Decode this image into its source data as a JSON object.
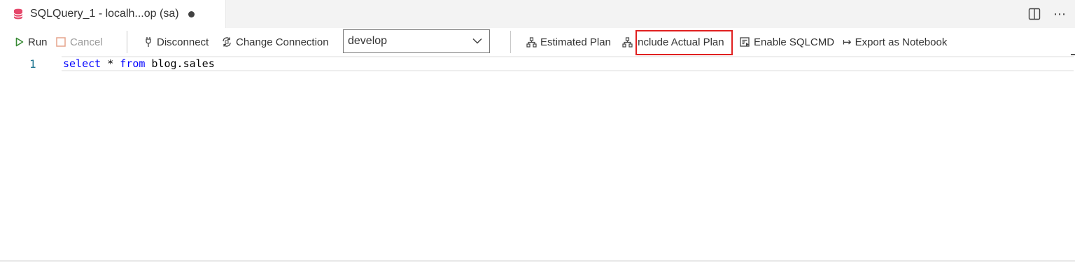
{
  "tab": {
    "title": "SQLQuery_1 - localh...op (sa)",
    "icon": "database-icon",
    "icon_color": "#e5476a"
  },
  "tabbar_actions": {
    "split_icon": "split-editor-icon",
    "more_icon": "more-actions-icon",
    "more_glyph": "⋯"
  },
  "toolbar": {
    "run_label": "Run",
    "cancel_label": "Cancel",
    "disconnect_label": "Disconnect",
    "change_connection_label": "Change Connection",
    "database_selected": "develop",
    "estimated_plan_label": "Estimated Plan",
    "include_actual_plan_label": "Include Actual Plan",
    "enable_sqlcmd_label": "Enable SQLCMD",
    "export_notebook_label": "Export as Notebook",
    "export_glyph": "↦",
    "run_color": "#388a34",
    "cancel_color": "#e5a48c",
    "highlight_color": "#e02020"
  },
  "editor": {
    "line_number": "1",
    "code": {
      "kw1": "select",
      "star": " * ",
      "kw2": "from",
      "rest": " blog.sales"
    }
  }
}
